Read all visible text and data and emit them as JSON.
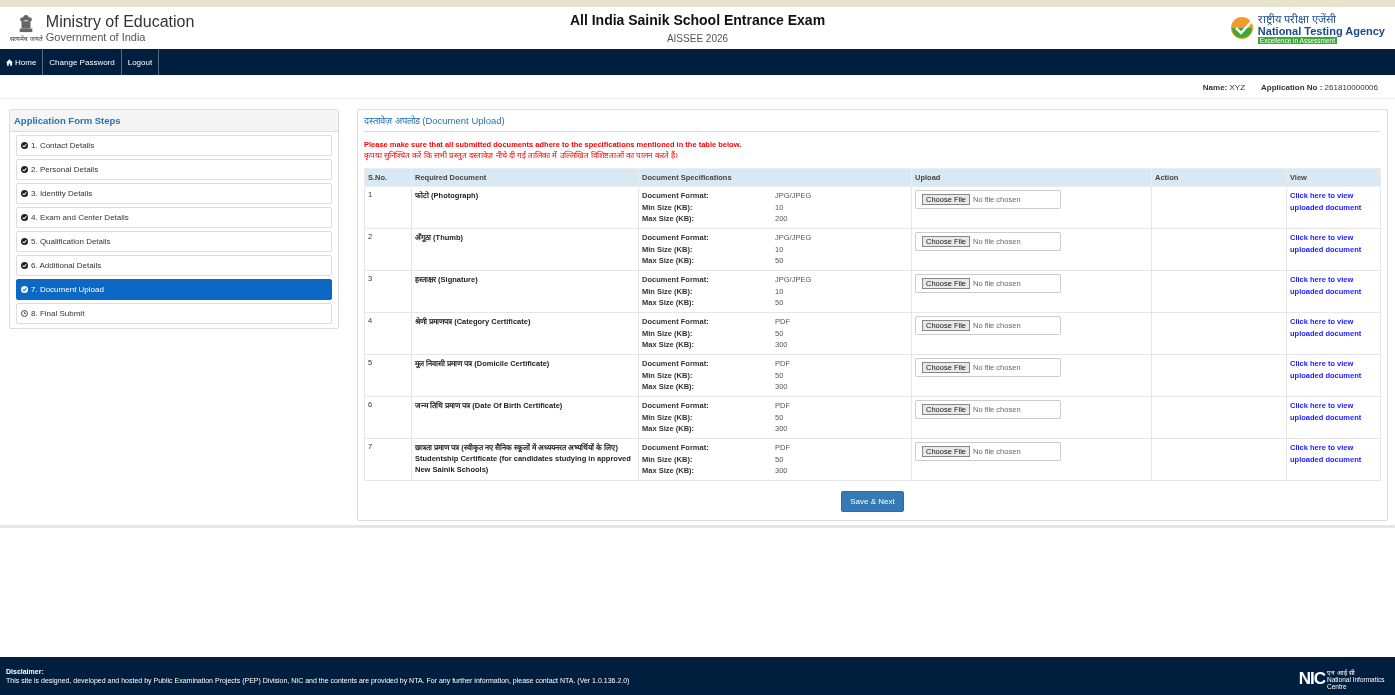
{
  "header": {
    "ministry": "Ministry of Education",
    "government": "Government of India",
    "emblem_motto": "सत्यमेव जयते",
    "exam_title": "All India Sainik School Entrance Exam",
    "exam_code": "AISSEE 2026",
    "agency_hindi": "राष्ट्रीय परीक्षा एजेंसी",
    "agency": "National Testing Agency",
    "agency_tagline": "Excellence in Assessment"
  },
  "nav": [
    {
      "label": "Home",
      "kind": "home"
    },
    {
      "label": "Change Password",
      "kind": "text"
    },
    {
      "label": "Logout",
      "kind": "text"
    }
  ],
  "candidate": {
    "name_label": "Name:",
    "name": "XYZ",
    "app_label": "Application No :",
    "app_no": "261810000006"
  },
  "sidebar": {
    "title": "Application Form Steps",
    "items": [
      {
        "label": "1. Contact Details",
        "completed": true,
        "selected": false
      },
      {
        "label": "2. Personal Details",
        "completed": true,
        "selected": false
      },
      {
        "label": "3. Identity Details",
        "completed": true,
        "selected": false
      },
      {
        "label": "4. Exam and Center Details",
        "completed": true,
        "selected": false
      },
      {
        "label": "5. Qualification Details",
        "completed": true,
        "selected": false
      },
      {
        "label": "6. Additional Details",
        "completed": true,
        "selected": false
      },
      {
        "label": "7. Document Upload",
        "completed": true,
        "selected": true
      },
      {
        "label": "8. Final Submit",
        "completed": false,
        "selected": false
      }
    ]
  },
  "panel": {
    "title": "दस्तावेज़ अपलोड (Document Upload)",
    "notice_en": "Please make sure that all submitted documents adhere to the specifications mentioned in the table below.",
    "notice_hi": "कृपया सुनिश्चित करें कि सभी प्रस्तुत दस्तावेज़ नीचे दी गई तालिका में उल्लिखित विशिष्टताओं का पालन करते हैं।"
  },
  "table": {
    "columns": [
      "S.No.",
      "Required Document",
      "Document Specifications",
      "Upload",
      "Action",
      "View"
    ],
    "rows": [
      {
        "sno": "1",
        "document": "फोटो (Photograph)",
        "specs": [
          {
            "label": "Document Format:",
            "value": "JPG/JPEG"
          },
          {
            "label": "Min Size (KB):",
            "value": "10"
          },
          {
            "label": "Max Size (KB):",
            "value": "200"
          }
        ],
        "upload_button": "Choose File",
        "upload_status": "No file chosen",
        "view": "Click here to view uploaded document"
      },
      {
        "sno": "2",
        "document": "अँगूठा (Thumb)",
        "specs": [
          {
            "label": "Document Format:",
            "value": "JPG/JPEG"
          },
          {
            "label": "Min Size (KB):",
            "value": "10"
          },
          {
            "label": "Max Size (KB):",
            "value": "50"
          }
        ],
        "upload_button": "Choose File",
        "upload_status": "No file chosen",
        "view": "Click here to view uploaded document"
      },
      {
        "sno": "3",
        "document": "हस्ताक्षर (Signature)",
        "specs": [
          {
            "label": "Document Format:",
            "value": "JPG/JPEG"
          },
          {
            "label": "Min Size (KB):",
            "value": "10"
          },
          {
            "label": "Max Size (KB):",
            "value": "50"
          }
        ],
        "upload_button": "Choose File",
        "upload_status": "No file chosen",
        "view": "Click here to view uploaded document"
      },
      {
        "sno": "4",
        "document": "श्रेणी प्रमाणपत्र (Category Certificate)",
        "specs": [
          {
            "label": "Document Format:",
            "value": "PDF"
          },
          {
            "label": "Min Size (KB):",
            "value": "50"
          },
          {
            "label": "Max Size (KB):",
            "value": "300"
          }
        ],
        "upload_button": "Choose File",
        "upload_status": "No file chosen",
        "view": "Click here to view uploaded document"
      },
      {
        "sno": "5",
        "document": "मूल निवासी प्रमाण पत्र (Domicile Certificate)",
        "specs": [
          {
            "label": "Document Format:",
            "value": "PDF"
          },
          {
            "label": "Min Size (KB):",
            "value": "50"
          },
          {
            "label": "Max Size (KB):",
            "value": "300"
          }
        ],
        "upload_button": "Choose File",
        "upload_status": "No file chosen",
        "view": "Click here to view uploaded document"
      },
      {
        "sno": "6",
        "document": "जन्म तिथि प्रमाण पत्र (Date Of Birth Certificate)",
        "specs": [
          {
            "label": "Document Format:",
            "value": "PDF"
          },
          {
            "label": "Min Size (KB):",
            "value": "50"
          },
          {
            "label": "Max Size (KB):",
            "value": "300"
          }
        ],
        "upload_button": "Choose File",
        "upload_status": "No file chosen",
        "view": "Click here to view uploaded document"
      },
      {
        "sno": "7",
        "document": "छात्रता प्रमाण पत्र (स्वीकृत नए सैनिक स्कूलों में अध्ययनरत अभ्यर्थियों के लिए) Studentship Certificate (for candidates studying in approved New Sainik Schools)",
        "specs": [
          {
            "label": "Document Format:",
            "value": "PDF"
          },
          {
            "label": "Min Size (KB):",
            "value": "50"
          },
          {
            "label": "Max Size (KB):",
            "value": "300"
          }
        ],
        "upload_button": "Choose File",
        "upload_status": "No file chosen",
        "view": "Click here to view uploaded document"
      }
    ]
  },
  "save_button": "Save & Next",
  "footer": {
    "title": "Disclaimer:",
    "text": "This site is designed, developed and hosted by Public Examination Projects (PEP) Division, NIC and the contents are provided by NTA. For any further information, please contact NTA. (Ver 1.0.136.2.0)",
    "nic": "NIC",
    "nic_hindi": "एन आई सी",
    "nic_name": "National Informatics Centre"
  }
}
